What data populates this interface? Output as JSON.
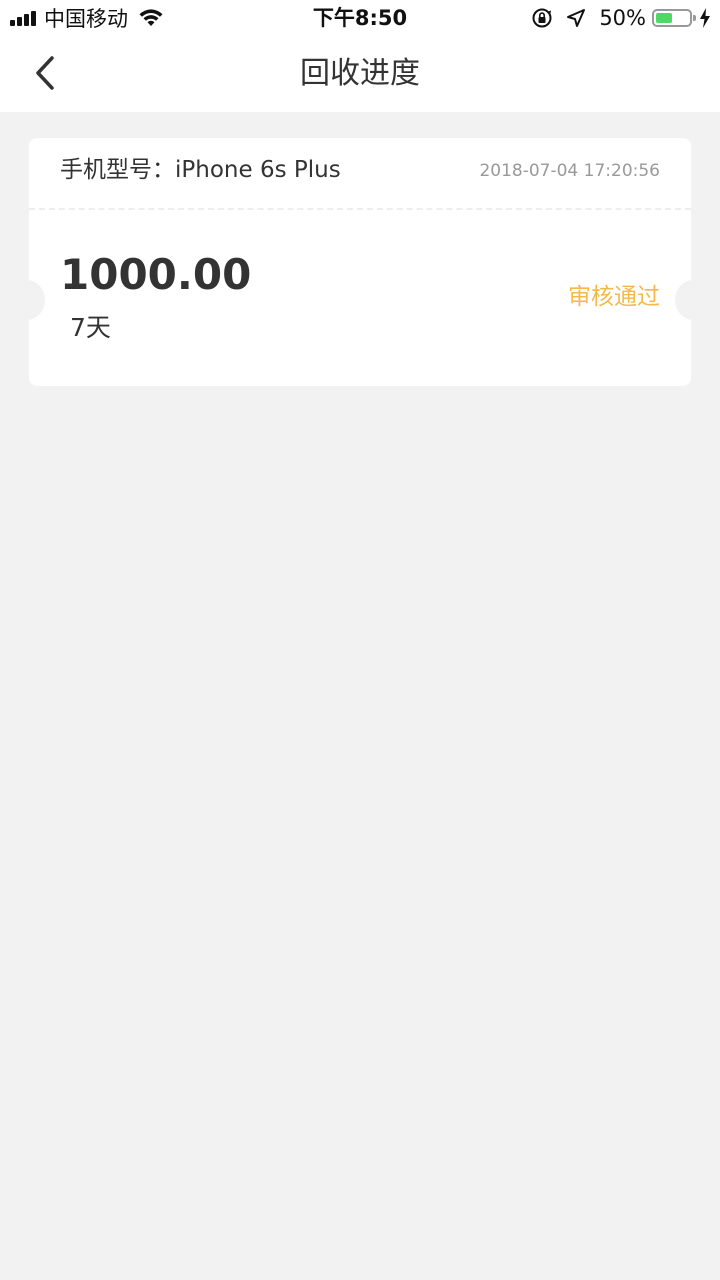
{
  "status_bar": {
    "carrier": "中国移动",
    "time": "下午8:50",
    "battery_percent": "50%",
    "battery_level": 0.5,
    "icons": [
      "signal-icon",
      "wifi-icon",
      "orientation-lock-icon",
      "location-icon",
      "battery-icon",
      "charging-icon"
    ]
  },
  "nav": {
    "back_icon": "chevron-left-icon",
    "title": "回收进度"
  },
  "order_card": {
    "model_label": "手机型号：iPhone 6s Plus",
    "timestamp": "2018-07-04 17:20:56",
    "amount": "1000.00",
    "duration": "7天",
    "status": "审核通过"
  },
  "colors": {
    "background": "#f2f2f2",
    "card": "#ffffff",
    "status_accent": "#f5b94b",
    "battery_fill": "#4cd964"
  }
}
